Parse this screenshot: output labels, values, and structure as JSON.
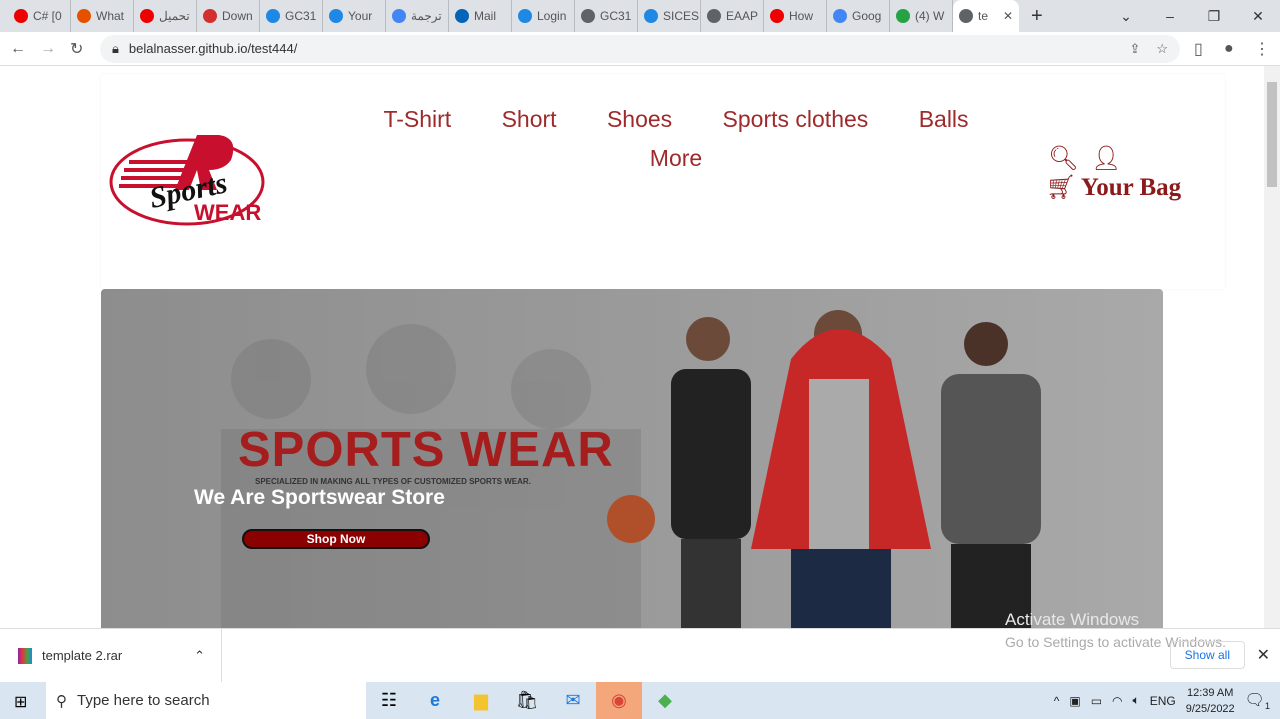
{
  "browser": {
    "tabs": [
      {
        "label": "C# [0",
        "color": "#e00"
      },
      {
        "label": "What",
        "color": "#e65100"
      },
      {
        "label": "تحميل",
        "color": "#e00"
      },
      {
        "label": "Down",
        "color": "#d32f2f"
      },
      {
        "label": "GC31",
        "color": "#1e88e5"
      },
      {
        "label": "Your",
        "color": "#1e88e5"
      },
      {
        "label": "ترجمة",
        "color": "#4285f4"
      },
      {
        "label": "Mail",
        "color": "#0364b8"
      },
      {
        "label": "Login",
        "color": "#1e88e5"
      },
      {
        "label": "GC31",
        "color": "#5f6368"
      },
      {
        "label": "SICES",
        "color": "#1e88e5"
      },
      {
        "label": "EAAP",
        "color": "#5f6368"
      },
      {
        "label": "How",
        "color": "#e00"
      },
      {
        "label": "Goog",
        "color": "#4285f4"
      },
      {
        "label": "(4) W",
        "color": "#25a244"
      },
      {
        "label": "te",
        "color": "#5f6368",
        "active": true
      }
    ],
    "url": "belalnasser.github.io/test444/"
  },
  "site": {
    "logo_text": "Sports WEAR",
    "menu": [
      "T-Shirt",
      "Short",
      "Shoes",
      "Sports clothes",
      "Balls",
      "More"
    ],
    "bag_label": "Your Bag",
    "banner": {
      "title": "SPORTS WEAR",
      "subtitle": "SPECIALIZED IN MAKING ALL TYPES OF CUSTOMIZED SPORTS WEAR.",
      "tagline": "We Are Sportswear Store",
      "button": "Shop Now"
    }
  },
  "watermark": {
    "line1": "Activate Windows",
    "line2": "Go to Settings to activate Windows."
  },
  "downloads": {
    "file": "template 2.rar",
    "show_all": "Show all"
  },
  "taskbar": {
    "search_placeholder": "Type here to search",
    "lang": "ENG",
    "time": "12:39 AM",
    "date": "9/25/2022",
    "notifications": "1"
  }
}
